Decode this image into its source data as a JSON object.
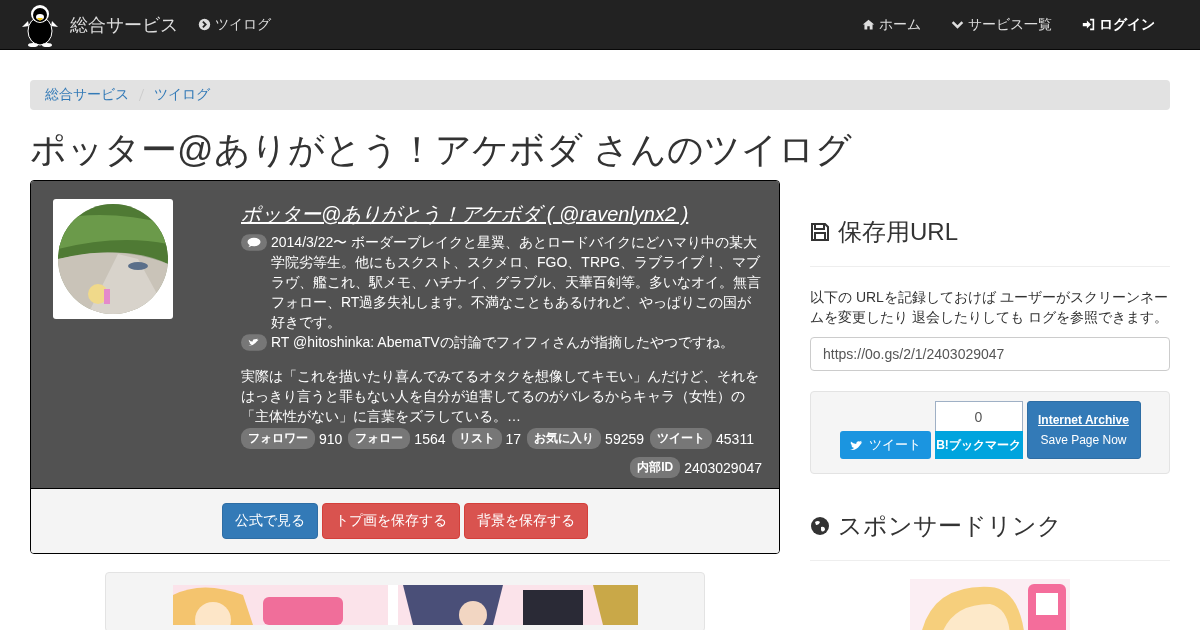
{
  "navbar": {
    "brand": "総合サービス",
    "section_link": "ツイログ",
    "menu": [
      {
        "kind": "home",
        "label": "ホーム",
        "bold": false
      },
      {
        "kind": "services",
        "label": "サービス一覧",
        "bold": false
      },
      {
        "kind": "login",
        "label": "ログイン",
        "bold": true
      }
    ]
  },
  "breadcrumb": [
    "総合サービス",
    "ツイログ"
  ],
  "page_title": "ポッター@ありがとう！アケボダ さんのツイログ",
  "profile": {
    "name_link": "ポッター@ありがとう！アケボダ ( @ravenlynx2 )",
    "bio": "2014/3/22〜 ボーダーブレイクと星翼、あとロードバイクにどハマり中の某大学院劣等生。他にもスクスト、スクメロ、FGO、TRPG、ラブライブ！、マブラヴ、艦これ、駅メモ、ハチナイ、グラブル、天華百剣等。多いなオイ。無言フォロー、RT過多失礼します。不満なこともあるけれど、やっぱりこの国が好きです。",
    "latest_tweet": "RT @hitoshinka: AbemaTVの討論でフィフィさんが指摘したやつですね。",
    "tweet_continuation": "実際は「これを描いたり喜んでみてるオタクを想像してキモい」んだけど、それをはっきり言うと罪もない人を自分が迫害してるのがバレるからキャラ（女性）の「主体性がない」に言葉をズラしている。…",
    "stats": [
      {
        "label": "フォロワー",
        "value": "910"
      },
      {
        "label": "フォロー",
        "value": "1564"
      },
      {
        "label": "リスト",
        "value": "17"
      },
      {
        "label": "お気に入り",
        "value": "59259"
      },
      {
        "label": "ツイート",
        "value": "45311"
      }
    ],
    "internal_id": {
      "label": "内部ID",
      "value": "2403029047"
    },
    "buttons": [
      {
        "kind": "primary",
        "label": "公式で見る"
      },
      {
        "kind": "danger",
        "label": "トプ画を保存する"
      },
      {
        "kind": "danger",
        "label": "背景を保存する"
      }
    ]
  },
  "save_url": {
    "heading": "保存用URL",
    "description": "以下の URLを記録しておけば ユーザーがスクリーンネームを変更したり 退会したりしても ログを参照できます。",
    "url": "https://0o.gs/2/1/2403029047",
    "tweet_button": "ツイート",
    "bookmark_count": "0",
    "bookmark_button": "B!ブックマーク",
    "archive_title": "Internet Archive",
    "archive_action": "Save Page Now"
  },
  "sponsored": {
    "heading": "スポンサードリンク"
  }
}
